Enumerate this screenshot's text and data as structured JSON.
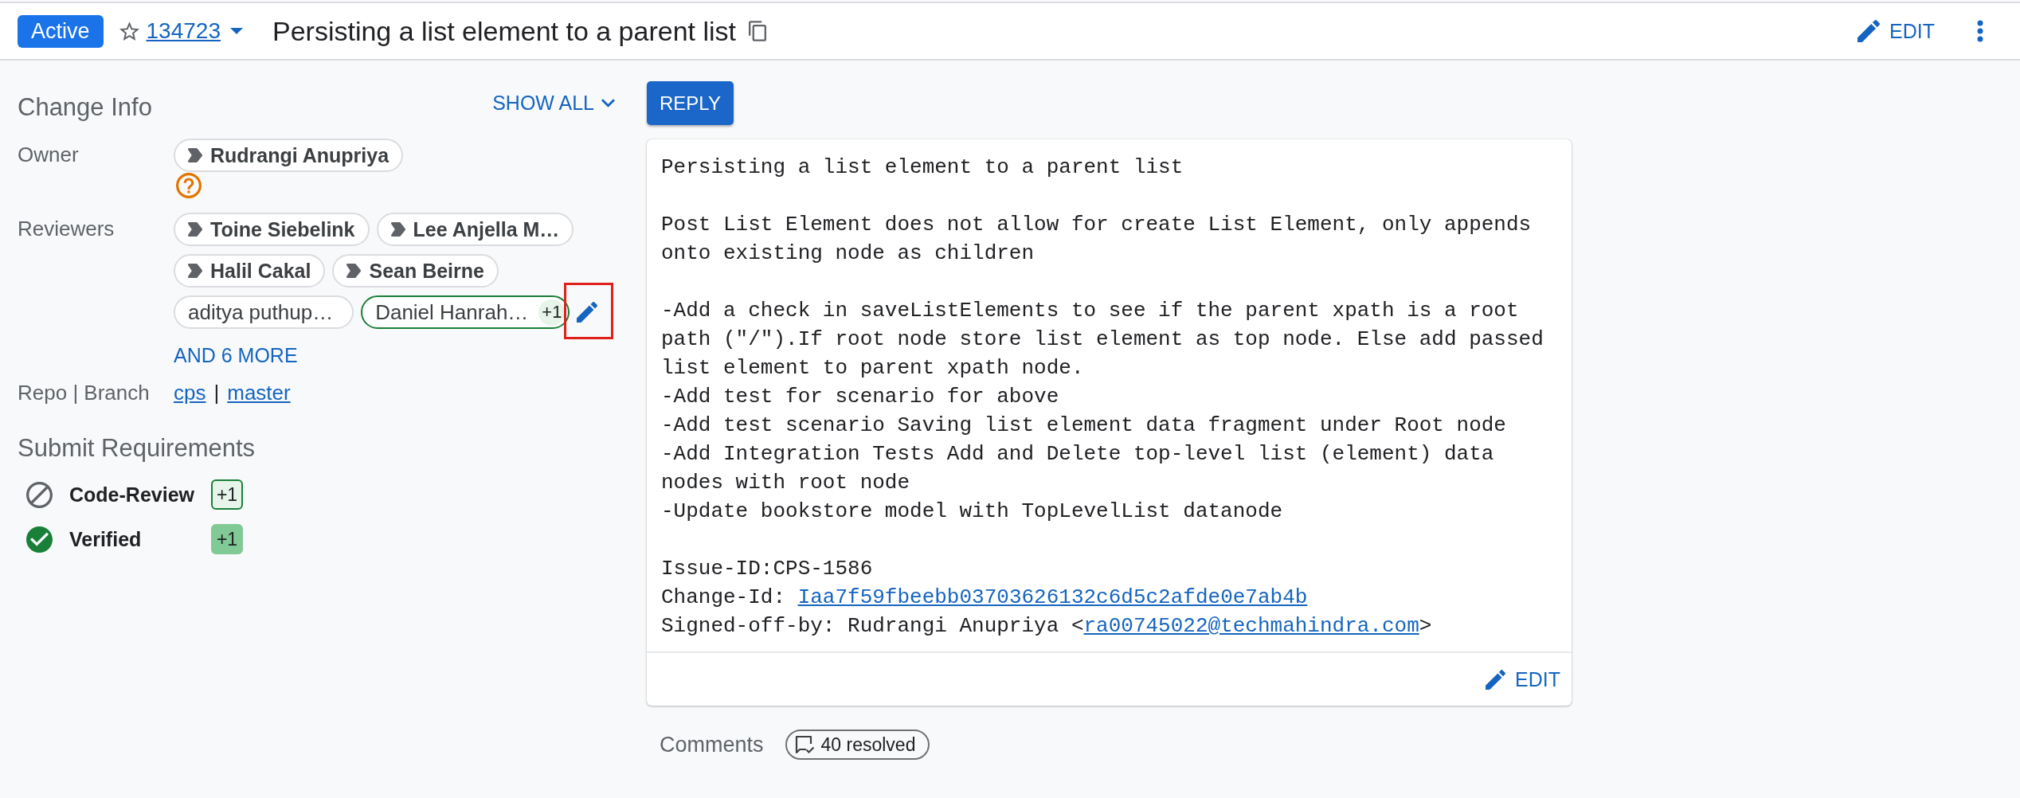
{
  "header": {
    "status": "Active",
    "starred": false,
    "change_number": "134723",
    "title": "Persisting a list element to a parent list",
    "edit_label": "EDIT"
  },
  "change_info": {
    "title": "Change Info",
    "show_all": "SHOW ALL",
    "owner": {
      "label": "Owner",
      "name": "Rudrangi Anupriya",
      "attention": true
    },
    "reviewers": {
      "label": "Reviewers",
      "people": [
        {
          "name": "Toine Siebelink",
          "attention": true
        },
        {
          "name": "Lee Anjella M…",
          "attention": true
        },
        {
          "name": "Halil Cakal",
          "attention": true
        },
        {
          "name": "Sean Beirne",
          "attention": true
        },
        {
          "name": "aditya puthup…",
          "attention": false
        },
        {
          "name": "Daniel Hanrah…",
          "attention": false,
          "vote": "+1"
        }
      ],
      "edit_highlighted": true,
      "more": "AND 6 MORE"
    },
    "repo_branch": {
      "label": "Repo | Branch",
      "repo": "cps",
      "separator": "|",
      "branch": "master"
    }
  },
  "submit_requirements": {
    "title": "Submit Requirements",
    "items": [
      {
        "name": "Code-Review",
        "satisfied": false,
        "vote": "+1",
        "vote_max": false
      },
      {
        "name": "Verified",
        "satisfied": true,
        "vote": "+1",
        "vote_max": true
      }
    ]
  },
  "reply_button": "REPLY",
  "commit_message": {
    "blocks": [
      [
        {
          "text": "Persisting a list element to a parent list"
        }
      ],
      [
        {
          "text": "Post List Element does not allow for create List Element, only appends onto existing node as children"
        }
      ],
      [
        {
          "text": "-Add a check in saveListElements to see if the parent xpath is a root path (\"/\").If root node store list element as top node. Else add passed list element to parent xpath node."
        },
        {
          "text": "-Add test for scenario for above"
        },
        {
          "text": "-Add test scenario Saving list element data fragment under Root node"
        },
        {
          "text": "-Add Integration Tests Add and Delete top-level list (element) data nodes with root node"
        },
        {
          "text": "-Update bookstore model with TopLevelList datanode"
        }
      ],
      [
        {
          "text": "Issue-ID:CPS-1586"
        },
        {
          "text": "Change-Id: ",
          "change_id": "Iaa7f59fbeebb03703626132c6d5c2afde0e7ab4b"
        },
        {
          "text": "Signed-off-by: Rudrangi Anupriya <",
          "email": "ra00745022@techmahindra.com",
          "after": ">"
        }
      ]
    ],
    "edit_label": "EDIT"
  },
  "comments": {
    "label": "Comments",
    "resolved": "40 resolved"
  }
}
